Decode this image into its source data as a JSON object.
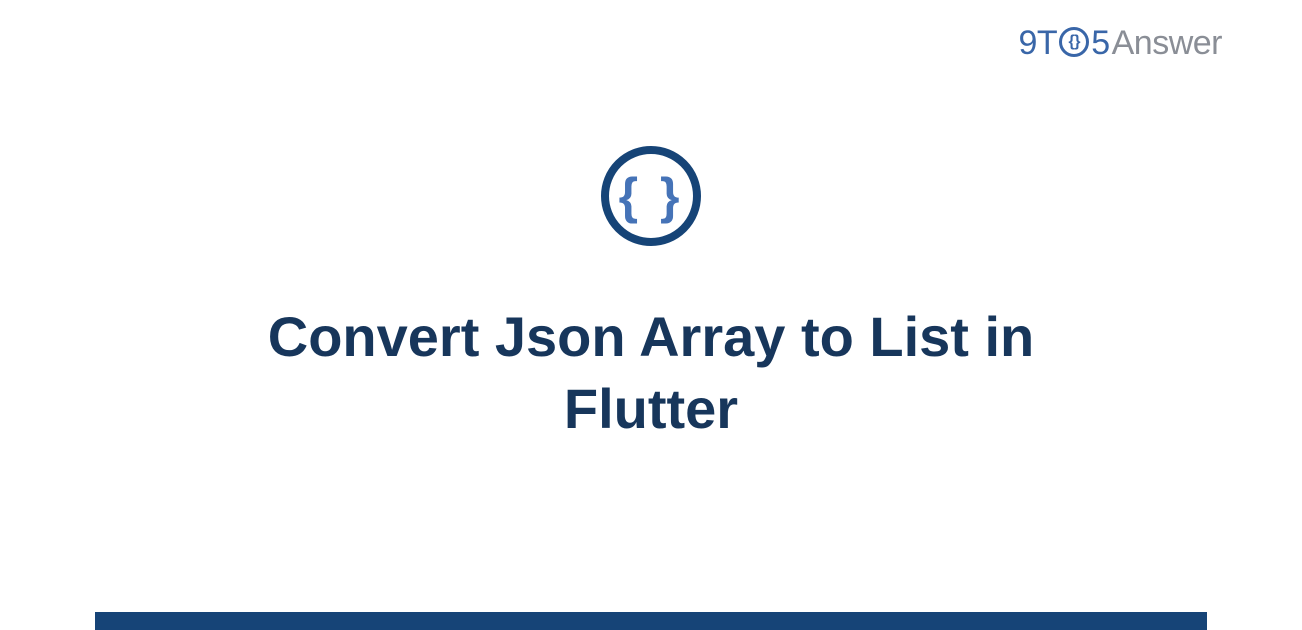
{
  "brand": {
    "part1": "9T",
    "o_content": "{}",
    "part2": "5",
    "part3": "Answer"
  },
  "logo": {
    "braces": "{ }"
  },
  "title": "Convert Json Array to List in Flutter"
}
